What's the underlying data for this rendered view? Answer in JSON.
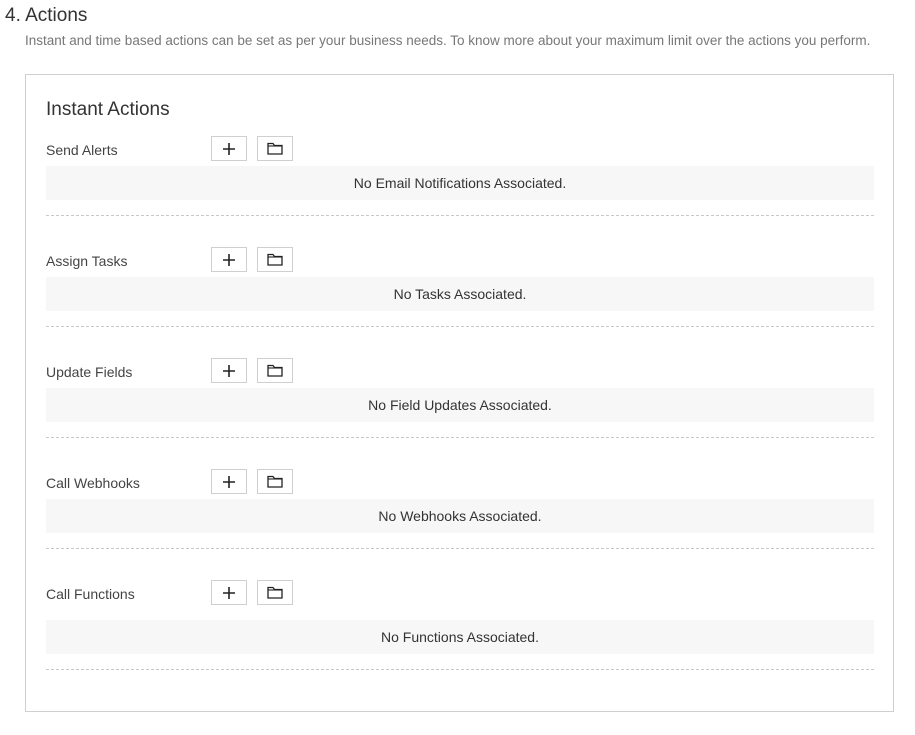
{
  "section": {
    "title": "4. Actions",
    "description": "Instant and time based actions can be set as per your business needs. To know more about your maximum limit over the actions you perform."
  },
  "panel": {
    "title": "Instant Actions",
    "groups": [
      {
        "label": "Send Alerts",
        "empty_text": "No Email Notifications Associated.",
        "add_icon": "plus-icon",
        "folder_icon": "folder-icon"
      },
      {
        "label": "Assign Tasks",
        "empty_text": "No Tasks Associated.",
        "add_icon": "plus-icon",
        "folder_icon": "folder-icon"
      },
      {
        "label": "Update Fields",
        "empty_text": "No Field Updates Associated.",
        "add_icon": "plus-icon",
        "folder_icon": "folder-icon"
      },
      {
        "label": "Call Webhooks",
        "empty_text": "No Webhooks Associated.",
        "add_icon": "plus-icon",
        "folder_icon": "folder-icon"
      },
      {
        "label": "Call Functions",
        "empty_text": "No Functions Associated.",
        "add_icon": "plus-icon",
        "folder_icon": "folder-icon"
      }
    ]
  }
}
